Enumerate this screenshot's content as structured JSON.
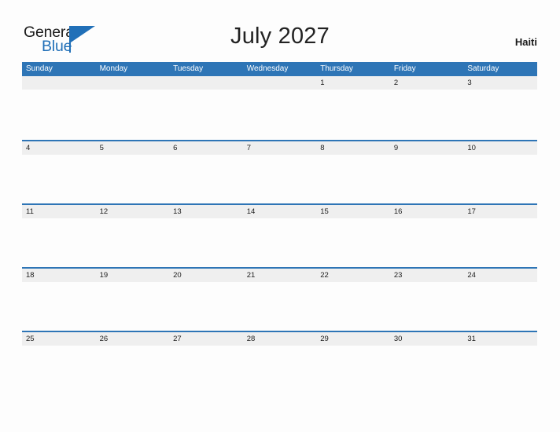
{
  "logo": {
    "text_primary": "General",
    "text_secondary": "Blue",
    "triangle_icon": "blue-triangle-icon",
    "brand_color": "#2170b8"
  },
  "header": {
    "title": "July 2027",
    "country": "Haiti",
    "month": "July",
    "year": "2027"
  },
  "colors": {
    "header_blue": "#2e75b6",
    "rule_blue": "#2e75b6",
    "date_band_gray": "#efefef",
    "page_background": "#fdfdfd",
    "title_text": "#222222",
    "date_text": "#1c1c1c",
    "weekday_text": "#ffffff"
  },
  "calendar": {
    "weekdays": [
      "Sunday",
      "Monday",
      "Tuesday",
      "Wednesday",
      "Thursday",
      "Friday",
      "Saturday"
    ],
    "weeks": [
      {
        "days": [
          "",
          "",
          "",
          "",
          "1",
          "2",
          "3"
        ]
      },
      {
        "days": [
          "4",
          "5",
          "6",
          "7",
          "8",
          "9",
          "10"
        ]
      },
      {
        "days": [
          "11",
          "12",
          "13",
          "14",
          "15",
          "16",
          "17"
        ]
      },
      {
        "days": [
          "18",
          "19",
          "20",
          "21",
          "22",
          "23",
          "24"
        ]
      },
      {
        "days": [
          "25",
          "26",
          "27",
          "28",
          "29",
          "30",
          "31"
        ]
      }
    ]
  }
}
